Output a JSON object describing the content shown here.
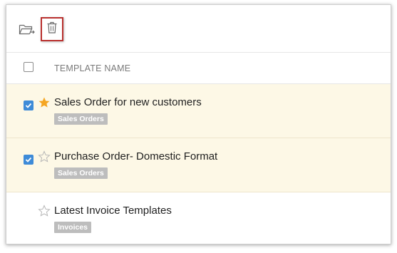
{
  "toolbar": {
    "move_icon": "folder-move-icon",
    "delete_icon": "trash-icon"
  },
  "table": {
    "column_header": "TEMPLATE NAME",
    "rows": [
      {
        "name": "Sales Order for new customers",
        "tag": "Sales Orders",
        "checked": true,
        "starred": true
      },
      {
        "name": "Purchase Order- Domestic Format",
        "tag": "Sales Orders",
        "checked": true,
        "starred": false
      },
      {
        "name": "Latest Invoice Templates",
        "tag": "Invoices",
        "checked": false,
        "starred": false
      }
    ]
  },
  "colors": {
    "selected_row_bg": "#fdf8e6",
    "checkbox_checked": "#3e8bd8",
    "star_filled": "#f5a623",
    "highlight_border": "#b9302e",
    "tag_bg": "#bdbdbd"
  }
}
